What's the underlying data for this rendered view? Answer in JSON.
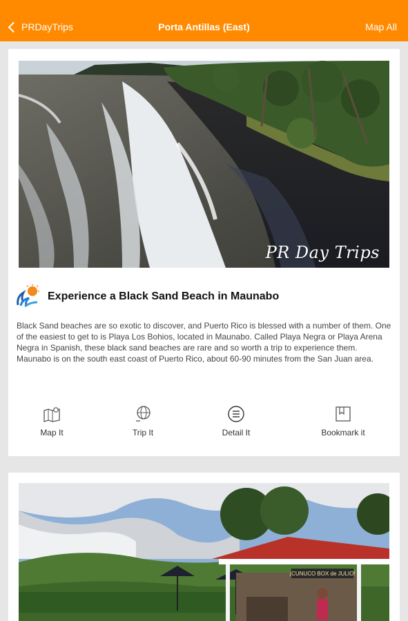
{
  "header": {
    "back_label": "PRDayTrips",
    "title": "Porta Antillas (East)",
    "map_all_label": "Map All",
    "bg_color": "#ff8a00"
  },
  "trip": {
    "watermark": "PR Day Trips",
    "category_icon": "beach-sun-waves-icon",
    "title": "Experience a Black Sand  Beach in Maunabo",
    "description": "Black Sand beaches are so exotic to discover, and Puerto Rico is blessed with a number of them.  One of the easiest to get to is Playa Los Bohios, located in Maunabo. Called Playa Negra or Playa Arena Negra in Spanish, these black sand beaches are rare and so worth a trip to experience them. Maunabo is on the south east coast of Puerto Rico, about 60-90 minutes from the San Juan area.",
    "actions": [
      {
        "label": "Map It",
        "icon": "map-icon"
      },
      {
        "label": "Trip It",
        "icon": "globe-icon"
      },
      {
        "label": "Detail It",
        "icon": "list-icon"
      },
      {
        "label": "Bookmark it",
        "icon": "bookmark-icon"
      }
    ]
  },
  "next_trip": {
    "sign_text": "¡CUNUCO BOX de JULIO!"
  }
}
